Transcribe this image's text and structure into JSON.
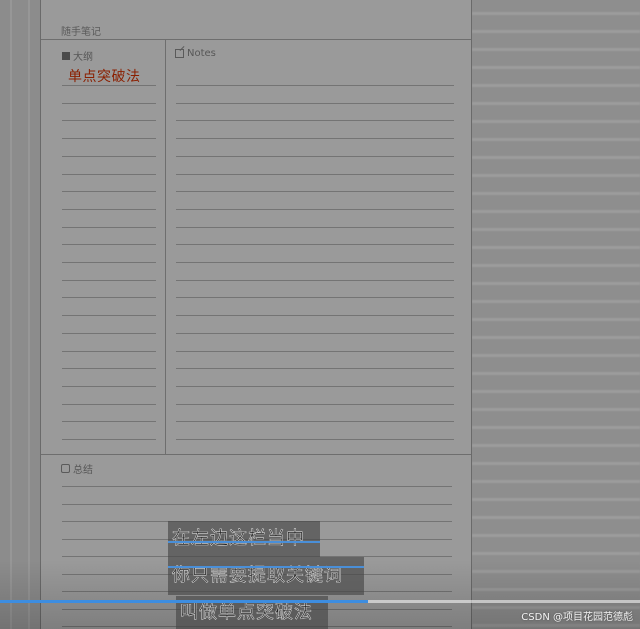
{
  "note": {
    "title": "随手笔记",
    "outline_label": "大纲",
    "outline_text": "单点突破法",
    "notes_label": "Notes",
    "summary_label": "总结"
  },
  "subtitles": {
    "line1": "在左边这栏当中",
    "line2": "你只需要提取关键词",
    "line3": "叫做单点突破法"
  },
  "player": {
    "progress": 0.575,
    "accent_color": "#3d8de0"
  },
  "watermark": "CSDN @项目花园范德彪",
  "icons": {
    "outline": "book-icon",
    "notes": "edit-icon",
    "summary": "summary-icon"
  }
}
